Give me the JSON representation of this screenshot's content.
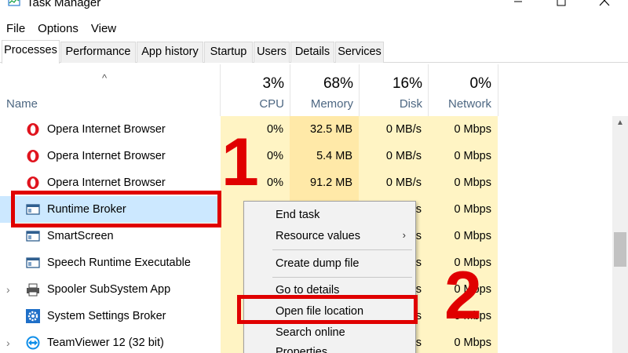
{
  "window": {
    "title": "Task Manager"
  },
  "menu": [
    "File",
    "Options",
    "View"
  ],
  "tabs": [
    "Processes",
    "Performance",
    "App history",
    "Startup",
    "Users",
    "Details",
    "Services"
  ],
  "header": {
    "name_label": "Name",
    "cpu": {
      "pct": "3%",
      "label": "CPU"
    },
    "memory": {
      "pct": "68%",
      "label": "Memory"
    },
    "disk": {
      "pct": "16%",
      "label": "Disk"
    },
    "network": {
      "pct": "0%",
      "label": "Network"
    }
  },
  "rows": [
    {
      "name": "Opera Internet Browser",
      "icon": "opera-icon",
      "cpu": "0%",
      "memory": "32.5 MB",
      "disk": "0 MB/s",
      "network": "0 Mbps"
    },
    {
      "name": "Opera Internet Browser",
      "icon": "opera-icon",
      "cpu": "0%",
      "memory": "5.4 MB",
      "disk": "0 MB/s",
      "network": "0 Mbps"
    },
    {
      "name": "Opera Internet Browser",
      "icon": "opera-icon",
      "cpu": "0%",
      "memory": "91.2 MB",
      "disk": "0 MB/s",
      "network": "0 Mbps"
    },
    {
      "name": "Runtime Broker",
      "icon": "window-icon",
      "disk": "s",
      "network": "0 Mbps",
      "selected": true
    },
    {
      "name": "SmartScreen",
      "icon": "window-icon",
      "disk": "s",
      "network": "0 Mbps"
    },
    {
      "name": "Speech Runtime Executable",
      "icon": "window-icon",
      "disk": "s",
      "network": "0 Mbps"
    },
    {
      "name": "Spooler SubSystem App",
      "icon": "printer-icon",
      "disk": "s",
      "network": "0 Mbps",
      "expandable": true
    },
    {
      "name": "System Settings Broker",
      "icon": "gear-icon",
      "disk": "s",
      "network": "0 Mbps"
    },
    {
      "name": "TeamViewer 12 (32 bit)",
      "icon": "teamviewer-icon",
      "disk": "s",
      "network": "0 Mbps",
      "expandable": true
    }
  ],
  "context_menu": {
    "items": [
      "End task",
      "Resource values",
      "Create dump file",
      "Go to details",
      "Open file location",
      "Search online",
      "Properties"
    ]
  },
  "annotations": {
    "step1": "1",
    "step2": "2"
  },
  "colors": {
    "annotation": "#e00000",
    "selected_row": "#cce8ff",
    "cpu_heat": "#fff4c4",
    "memory_heat": "#ffe9a8",
    "header_label": "#4d6782"
  }
}
